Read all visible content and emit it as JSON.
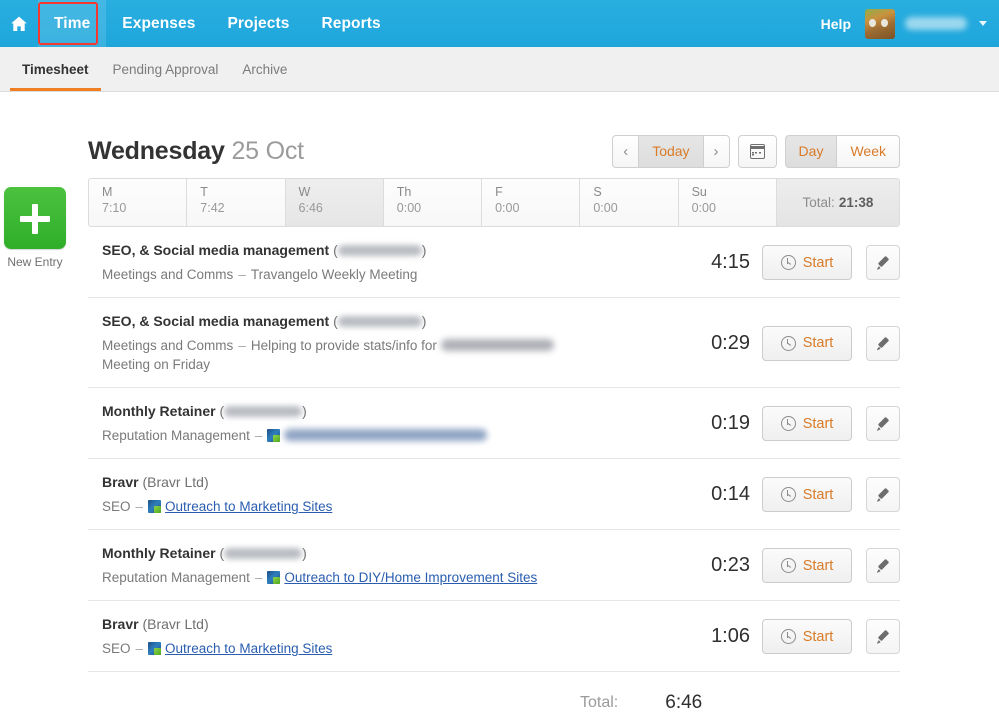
{
  "topnav": {
    "home_icon": "home-icon",
    "items": [
      {
        "label": "Time",
        "active": true
      },
      {
        "label": "Expenses",
        "active": false
      },
      {
        "label": "Projects",
        "active": false
      },
      {
        "label": "Reports",
        "active": false
      }
    ],
    "help_label": "Help",
    "username": "",
    "avatar_icon": "avatar",
    "caret_icon": "chevron-down-icon",
    "accent_color": "#24a9dd",
    "annotation_color": "#f5372f"
  },
  "subnav": {
    "items": [
      {
        "label": "Timesheet",
        "active": true
      },
      {
        "label": "Pending Approval",
        "active": false
      },
      {
        "label": "Archive",
        "active": false
      }
    ],
    "active_underline_color": "#ef7f22"
  },
  "new_entry": {
    "label": "New Entry",
    "icon": "plus-icon",
    "color": "#3cb82f"
  },
  "date_header": {
    "weekday": "Wednesday",
    "date": "25 Oct"
  },
  "date_controls": {
    "prev_label": "‹",
    "today_label": "Today",
    "next_label": "›",
    "calendar_icon": "calendar-icon",
    "day_label": "Day",
    "week_label": "Week",
    "day_selected": true,
    "week_selected": false
  },
  "week_strip": {
    "days": [
      {
        "name": "M",
        "hours": "7:10",
        "selected": false
      },
      {
        "name": "T",
        "hours": "7:42",
        "selected": false
      },
      {
        "name": "W",
        "hours": "6:46",
        "selected": true
      },
      {
        "name": "Th",
        "hours": "0:00",
        "selected": false
      },
      {
        "name": "F",
        "hours": "0:00",
        "selected": false
      },
      {
        "name": "S",
        "hours": "0:00",
        "selected": false
      },
      {
        "name": "Su",
        "hours": "0:00",
        "selected": false
      }
    ],
    "total_label": "Total:",
    "total_value": "21:38"
  },
  "entries": [
    {
      "title": "SEO, & Social media management",
      "client": "(████████)",
      "client_redacted": true,
      "client_redacted_width": 84,
      "task": "Meetings and Comms",
      "dash": "–",
      "note": "Travangelo Weekly Meeting",
      "note_redacted": false,
      "has_task_icon": false,
      "note_is_link": false,
      "duration": "4:15",
      "start_label": "Start",
      "edit_icon": "pencil-icon"
    },
    {
      "title": "SEO, & Social media management",
      "client": "(████████)",
      "client_redacted": true,
      "client_redacted_width": 84,
      "task": "Meetings and Comms",
      "dash": "–",
      "note": "Helping to provide stats/info for ",
      "note_tail": "Meeting on Friday",
      "note_redacted": true,
      "note_redacted_width": 113,
      "has_task_icon": false,
      "note_is_link": false,
      "duration": "0:29",
      "start_label": "Start",
      "edit_icon": "pencil-icon"
    },
    {
      "title": "Monthly Retainer",
      "client": "(███████)",
      "client_redacted": true,
      "client_redacted_width": 78,
      "task": "Reputation Management",
      "dash": "–",
      "note": "",
      "note_redacted": true,
      "note_redacted_width": 203,
      "has_task_icon": true,
      "note_is_link": true,
      "duration": "0:19",
      "start_label": "Start",
      "edit_icon": "pencil-icon"
    },
    {
      "title": "Bravr",
      "client": "(Bravr Ltd)",
      "client_redacted": false,
      "task": "SEO",
      "dash": "–",
      "note": "Outreach to Marketing Sites",
      "note_redacted": false,
      "has_task_icon": true,
      "note_is_link": true,
      "duration": "0:14",
      "start_label": "Start",
      "edit_icon": "pencil-icon"
    },
    {
      "title": "Monthly Retainer",
      "client": "(███████)",
      "client_redacted": true,
      "client_redacted_width": 78,
      "task": "Reputation Management",
      "dash": "–",
      "note": "Outreach to DIY/Home Improvement Sites",
      "note_redacted": false,
      "has_task_icon": true,
      "note_is_link": true,
      "duration": "0:23",
      "start_label": "Start",
      "edit_icon": "pencil-icon"
    },
    {
      "title": "Bravr",
      "client": "(Bravr Ltd)",
      "client_redacted": false,
      "task": "SEO",
      "dash": "–",
      "note": "Outreach to Marketing Sites",
      "note_redacted": false,
      "has_task_icon": true,
      "note_is_link": true,
      "duration": "1:06",
      "start_label": "Start",
      "edit_icon": "pencil-icon"
    }
  ],
  "footer": {
    "total_label": "Total:",
    "total_value": "6:46"
  }
}
